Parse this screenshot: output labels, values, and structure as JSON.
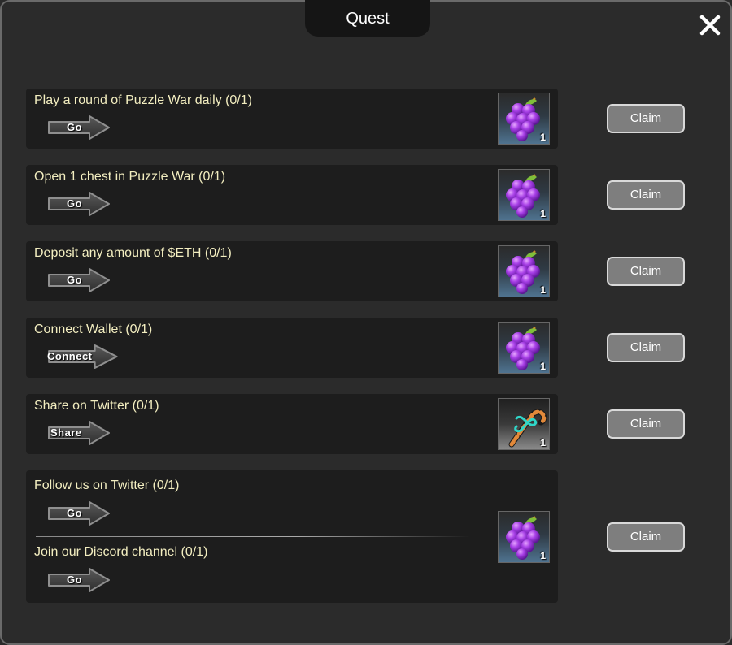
{
  "modal": {
    "title": "Quest"
  },
  "quests": [
    {
      "title": "Play a round of Puzzle War daily (0/1)",
      "action": "Go",
      "reward_icon": "grapes-icon",
      "reward_qty": "1",
      "claim": "Claim"
    },
    {
      "title": "Open 1 chest in Puzzle War (0/1)",
      "action": "Go",
      "reward_icon": "grapes-icon",
      "reward_qty": "1",
      "claim": "Claim"
    },
    {
      "title": "Deposit any amount of $ETH (0/1)",
      "action": "Go",
      "reward_icon": "grapes-icon",
      "reward_qty": "1",
      "claim": "Claim"
    },
    {
      "title": "Connect Wallet (0/1)",
      "action": "Connect",
      "reward_icon": "grapes-icon",
      "reward_qty": "1",
      "claim": "Claim"
    },
    {
      "title": "Share on Twitter (0/1)",
      "action": "Share",
      "reward_icon": "candy-cane-icon",
      "reward_qty": "1",
      "claim": "Claim"
    }
  ],
  "combined_quest": {
    "items": [
      {
        "title": "Follow us on Twitter (0/1)",
        "action": "Go"
      },
      {
        "title": "Join our Discord channel (0/1)",
        "action": "Go"
      }
    ],
    "reward_icon": "grapes-icon",
    "reward_qty": "1",
    "claim": "Claim"
  },
  "colors": {
    "quest_text": "#f3eec0",
    "claim_bg": "#7e7e7e",
    "panel_bg": "#1d1d1d"
  }
}
